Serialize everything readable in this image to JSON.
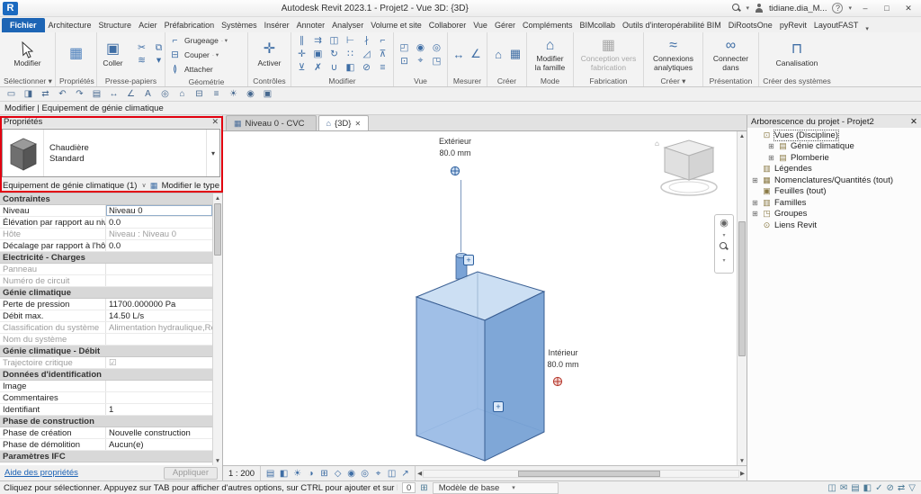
{
  "titlebar": {
    "app": "R",
    "title": "Autodesk Revit 2023.1 - Projet2 - Vue 3D: {3D}",
    "user": "tidiane.dia_M...",
    "help": "?",
    "minimize": "–",
    "restore": "□",
    "close": "✕",
    "chev": "▾"
  },
  "tabs": {
    "file": "Fichier",
    "items": [
      "Architecture",
      "Structure",
      "Acier",
      "Préfabrication",
      "Systèmes",
      "Insérer",
      "Annoter",
      "Analyser",
      "Volume et site",
      "Collaborer",
      "Vue",
      "Gérer",
      "Compléments",
      "BIMcollab",
      "Outils d'interopérabilité BIM",
      "DiRootsOne",
      "pyRevit",
      "LayoutFAST"
    ],
    "expand": "▾"
  },
  "ribbon": {
    "select": {
      "label": "Sélectionner",
      "chev": "▾",
      "modify": "Modifier"
    },
    "props": {
      "label": "Propriétés"
    },
    "clipboard": {
      "label": "Presse-papiers",
      "paste": "Coller"
    },
    "geometry": {
      "label": "Géométrie",
      "r1": "Grugeage",
      "r2": "Couper",
      "r3": "Attacher"
    },
    "controls": {
      "label": "Contrôles",
      "activate": "Activer"
    },
    "modify_panel": {
      "label": "Modifier",
      "tools": [
        {
          "name": "align-icon",
          "glyph": "∥"
        },
        {
          "name": "offset-icon",
          "glyph": "⇉"
        },
        {
          "name": "mirror-icon",
          "glyph": "◫"
        },
        {
          "name": "extend-icon",
          "glyph": "⊢"
        },
        {
          "name": "split-icon",
          "glyph": "∤"
        },
        {
          "name": "trim-icon",
          "glyph": "⌐"
        },
        {
          "name": "move-icon",
          "glyph": "✛"
        },
        {
          "name": "copy-icon",
          "glyph": "▣"
        },
        {
          "name": "rotate-icon",
          "glyph": "↻"
        },
        {
          "name": "array-icon",
          "glyph": "∷"
        },
        {
          "name": "scale-icon",
          "glyph": "◿"
        },
        {
          "name": "pin-icon",
          "glyph": "⊼"
        },
        {
          "name": "unpin-icon",
          "glyph": "⊻"
        },
        {
          "name": "delete-icon",
          "glyph": "✗"
        },
        {
          "name": "join-icon",
          "glyph": "∪"
        },
        {
          "name": "paint-icon",
          "glyph": "◧"
        },
        {
          "name": "cut-geometry-icon",
          "glyph": "⊘"
        },
        {
          "name": "match-properties-icon",
          "glyph": "≡"
        }
      ]
    },
    "view_panel": {
      "label": "Vue",
      "tools": [
        {
          "name": "hide-category-icon",
          "glyph": "◰"
        },
        {
          "name": "temporary-hide-icon",
          "glyph": "◉"
        },
        {
          "name": "reveal-hidden-icon",
          "glyph": "◎"
        },
        {
          "name": "cut-profile-icon",
          "glyph": "⊡"
        },
        {
          "name": "linework-icon",
          "glyph": "⌖"
        },
        {
          "name": "view-reference-icon",
          "glyph": "◳"
        }
      ]
    },
    "measure": {
      "label": "Mesurer",
      "tools": [
        {
          "name": "measure-icon",
          "glyph": "↔"
        },
        {
          "name": "dimension-icon",
          "glyph": "∠"
        }
      ]
    },
    "create": {
      "label": "Créer",
      "tools": [
        {
          "name": "create-similar-icon",
          "glyph": "⌂"
        },
        {
          "name": "detail-group-icon",
          "glyph": "▦"
        }
      ]
    },
    "mode": {
      "label": "Mode",
      "l1": "Modifier",
      "l2": "la famille"
    },
    "fabrication": {
      "label": "Fabrication",
      "l1": "Conception vers",
      "l2": "fabrication"
    },
    "create2": {
      "label": "Créer",
      "chev": "▾",
      "l1": "Connexions",
      "l2": "analytiques"
    },
    "presentation": {
      "label": "Présentation",
      "l1": "Connecter",
      "l2": "dans"
    },
    "systems": {
      "label": "Créer des systèmes",
      "l1": "Canalisation",
      "l2": ""
    }
  },
  "qat": [
    {
      "name": "open-icon",
      "glyph": "▭"
    },
    {
      "name": "save-icon",
      "glyph": "◨"
    },
    {
      "name": "sync-icon",
      "glyph": "⇄"
    },
    {
      "name": "undo-icon",
      "glyph": "↶"
    },
    {
      "name": "redo-icon",
      "glyph": "↷"
    },
    {
      "name": "print-icon",
      "glyph": "▤"
    },
    {
      "name": "measure-icon",
      "glyph": "↔"
    },
    {
      "name": "aligned-dimension-icon",
      "glyph": "∠"
    },
    {
      "name": "text-icon",
      "glyph": "A"
    },
    {
      "name": "tag-icon",
      "glyph": "◎"
    },
    {
      "name": "default-3d-view-icon",
      "glyph": "⌂"
    },
    {
      "name": "section-icon",
      "glyph": "⊟"
    },
    {
      "name": "thin-lines-icon",
      "glyph": "≡"
    },
    {
      "name": "sun-settings-icon",
      "glyph": "☀"
    },
    {
      "name": "render-icon",
      "glyph": "◉"
    },
    {
      "name": "switch-windows-icon",
      "glyph": "▣"
    }
  ],
  "modebar": "Modifier | Equipement de génie climatique",
  "properties": {
    "header": "Propriétés",
    "close": "✕",
    "type_name": "Chaudière",
    "type_variant": "Standard",
    "type_chev": "▾",
    "selection": "Equipement de génie climatique (1)",
    "selection_chev": "∨",
    "edit_type": "Modifier le type",
    "help": "Aide des propriétés",
    "apply": "Appliquer",
    "rows": [
      {
        "cls": "hdr",
        "label": "Contraintes",
        "value": ""
      },
      {
        "cls": "boxed",
        "label": "Niveau",
        "value": "Niveau 0"
      },
      {
        "cls": "",
        "label": "Élévation par rapport au nive...",
        "value": "0.0"
      },
      {
        "cls": "dim",
        "label": "Hôte",
        "value": "Niveau : Niveau 0"
      },
      {
        "cls": "",
        "label": "Décalage par rapport à l'hôte",
        "value": "0.0"
      },
      {
        "cls": "hdr",
        "label": "Electricité - Charges",
        "value": ""
      },
      {
        "cls": "dim",
        "label": "Panneau",
        "value": ""
      },
      {
        "cls": "dim",
        "label": "Numéro de circuit",
        "value": ""
      },
      {
        "cls": "hdr",
        "label": "Génie climatique",
        "value": ""
      },
      {
        "cls": "",
        "label": "Perte de pression",
        "value": "11700.000000 Pa"
      },
      {
        "cls": "",
        "label": "Débit max.",
        "value": "14.50 L/s"
      },
      {
        "cls": "dim",
        "label": "Classification du système",
        "value": "Alimentation hydraulique,Ret..."
      },
      {
        "cls": "dim",
        "label": "Nom du système",
        "value": ""
      },
      {
        "cls": "hdr",
        "label": "Génie climatique - Débit",
        "value": ""
      },
      {
        "cls": "dim",
        "label": "Trajectoire critique",
        "value": "☑"
      },
      {
        "cls": "hdr",
        "label": "Données d'identification",
        "value": ""
      },
      {
        "cls": "",
        "label": "Image",
        "value": ""
      },
      {
        "cls": "",
        "label": "Commentaires",
        "value": ""
      },
      {
        "cls": "",
        "label": "Identifiant",
        "value": "1"
      },
      {
        "cls": "hdr",
        "label": "Phase de construction",
        "value": ""
      },
      {
        "cls": "",
        "label": "Phase de création",
        "value": "Nouvelle construction"
      },
      {
        "cls": "",
        "label": "Phase de démolition",
        "value": "Aucun(e)"
      },
      {
        "cls": "hdr",
        "label": "Paramètres IFC",
        "value": ""
      }
    ]
  },
  "viewtabs": [
    {
      "cls": "",
      "icon": "▦",
      "label": "Niveau 0 - CVC"
    },
    {
      "cls": "active",
      "icon": "⌂",
      "label": "{3D}",
      "close": "✕"
    }
  ],
  "canvas": {
    "ext_label": "Extérieur",
    "ext_value": "80.0 mm",
    "int_label": "Intérieur",
    "int_value": "80.0 mm",
    "plus": "+"
  },
  "viewbar": {
    "scale": "1 : 200",
    "scale_chev": "▾",
    "tools": [
      {
        "name": "detail-level-icon",
        "glyph": "▤"
      },
      {
        "name": "visual-style-icon",
        "glyph": "◧"
      },
      {
        "name": "sun-path-icon",
        "glyph": "☀"
      },
      {
        "name": "shadows-icon",
        "glyph": "◑"
      },
      {
        "name": "crop-view-icon",
        "glyph": "⊞"
      },
      {
        "name": "crop-region-visibility-icon",
        "glyph": "◇"
      },
      {
        "name": "temporary-hide-isolate-icon",
        "glyph": "◉"
      },
      {
        "name": "reveal-hidden-elements-icon",
        "glyph": "◎"
      },
      {
        "name": "locked-3d-view-icon",
        "glyph": "⌖"
      },
      {
        "name": "worksharing-display-icon",
        "glyph": "◫"
      },
      {
        "name": "displacement-icon",
        "glyph": "↗"
      }
    ]
  },
  "browser": {
    "title": "Arborescence du projet - Projet2",
    "close": "✕",
    "items": [
      {
        "cls": "sel",
        "exp": "",
        "icon": "⊡",
        "label": "Vues (Discipline)"
      },
      {
        "cls": "d1",
        "exp": "⊞",
        "icon": "▤",
        "label": "Génie climatique"
      },
      {
        "cls": "d1",
        "exp": "⊞",
        "icon": "▤",
        "label": "Plomberie"
      },
      {
        "cls": "",
        "exp": "",
        "icon": "▥",
        "label": "Légendes"
      },
      {
        "cls": "",
        "exp": "⊞",
        "icon": "▦",
        "label": "Nomenclatures/Quantités (tout)"
      },
      {
        "cls": "",
        "exp": "",
        "icon": "▣",
        "label": "Feuilles (tout)"
      },
      {
        "cls": "",
        "exp": "⊞",
        "icon": "▥",
        "label": "Familles"
      },
      {
        "cls": "",
        "exp": "⊞",
        "icon": "◳",
        "label": "Groupes"
      },
      {
        "cls": "",
        "exp": "",
        "icon": "⊙",
        "label": "Liens Revit"
      }
    ]
  },
  "statusbar": {
    "hint": "Cliquez pour sélectionner. Appuyez sur TAB pour afficher d'autres options, sur CTRL pour ajouter et sur MAJ",
    "value": "0",
    "grid_icon": "⊞",
    "base_model": "Modèle de base",
    "model_chev": "▾",
    "right_icons": [
      {
        "name": "worksharing-icon",
        "glyph": "◫"
      },
      {
        "name": "editing-requests-icon",
        "glyph": "✉"
      },
      {
        "name": "worksets-icon",
        "glyph": "▤"
      },
      {
        "name": "design-options-icon",
        "glyph": "◧"
      },
      {
        "name": "editable-only-icon",
        "glyph": "✓"
      },
      {
        "name": "exclude-options-icon",
        "glyph": "⊘"
      },
      {
        "name": "press-drag-icon",
        "glyph": "⇄"
      },
      {
        "name": "selection-filter-icon",
        "glyph": "▽"
      }
    ]
  }
}
